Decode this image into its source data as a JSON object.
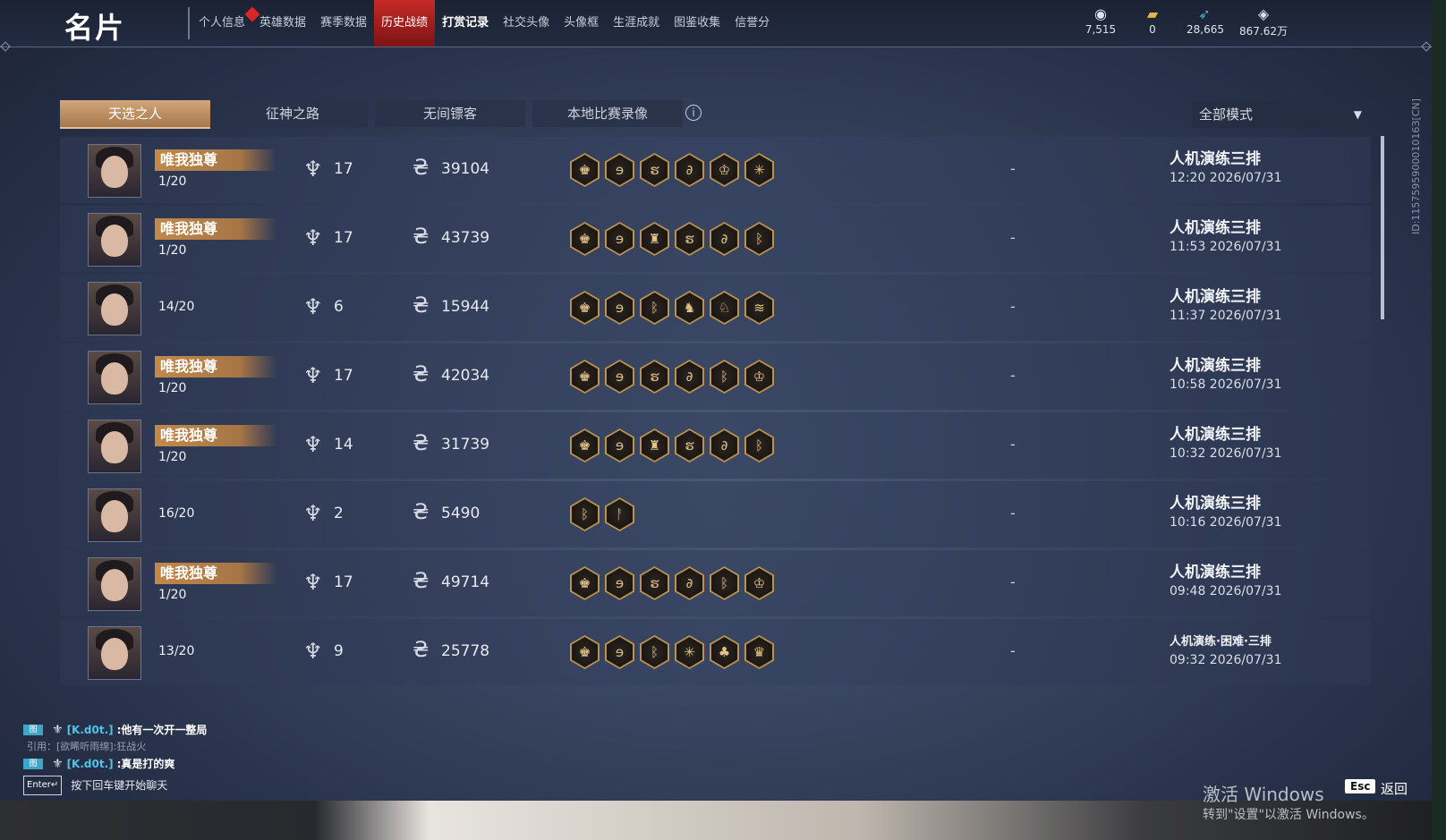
{
  "window": {
    "title": "名片"
  },
  "nav": {
    "tabs": [
      {
        "label": "个人信息"
      },
      {
        "label": "英雄数据"
      },
      {
        "label": "赛季数据"
      },
      {
        "label": "历史战绩"
      },
      {
        "label": "打赏记录"
      },
      {
        "label": "社交头像"
      },
      {
        "label": "头像框"
      },
      {
        "label": "生涯成就"
      },
      {
        "label": "图鉴收集"
      },
      {
        "label": "信誉分"
      }
    ],
    "active_index": 3
  },
  "currencies": [
    {
      "icon": "gold-ingot-icon",
      "value": "7,515"
    },
    {
      "icon": "ticket-icon",
      "value": "0"
    },
    {
      "icon": "feather-icon",
      "value": "28,665"
    },
    {
      "icon": "diamond-icon",
      "value": "867.62万"
    }
  ],
  "side_id": "ID:115759590001016З[CN]",
  "subtabs": [
    {
      "label": "天选之人"
    },
    {
      "label": "征神之路"
    },
    {
      "label": "无间镖客"
    },
    {
      "label": "本地比赛录像"
    }
  ],
  "mode_select": {
    "value": "全部模式"
  },
  "matches": [
    {
      "title": "唯我独尊",
      "rank": "1/20",
      "kills": "17",
      "money": "39104",
      "items": [
        "♚",
        "ɘ",
        "ຮ",
        "∂",
        "♔",
        "✳"
      ],
      "dash": "-",
      "mode": "人机演练三排",
      "time": "12:20  2026/07/31"
    },
    {
      "title": "唯我独尊",
      "rank": "1/20",
      "kills": "17",
      "money": "43739",
      "items": [
        "♚",
        "ɘ",
        "♜",
        "ຮ",
        "∂",
        "ᛒ"
      ],
      "dash": "-",
      "mode": "人机演练三排",
      "time": "11:53  2026/07/31"
    },
    {
      "title": "",
      "rank": "14/20",
      "kills": "6",
      "money": "15944",
      "items": [
        "♚",
        "ɘ",
        "ᛒ",
        "♞",
        "♘",
        "≋"
      ],
      "dash": "-",
      "mode": "人机演练三排",
      "time": "11:37  2026/07/31"
    },
    {
      "title": "唯我独尊",
      "rank": "1/20",
      "kills": "17",
      "money": "42034",
      "items": [
        "♚",
        "ɘ",
        "ຮ",
        "∂",
        "ᛒ",
        "♔"
      ],
      "dash": "-",
      "mode": "人机演练三排",
      "time": "10:58  2026/07/31"
    },
    {
      "title": "唯我独尊",
      "rank": "1/20",
      "kills": "14",
      "money": "31739",
      "items": [
        "♚",
        "ɘ",
        "♜",
        "ຮ",
        "∂",
        "ᛒ"
      ],
      "dash": "-",
      "mode": "人机演练三排",
      "time": "10:32  2026/07/31"
    },
    {
      "title": "",
      "rank": "16/20",
      "kills": "2",
      "money": "5490",
      "items": [
        "ᛒ",
        "ᚨ"
      ],
      "dash": "-",
      "mode": "人机演练三排",
      "time": "10:16  2026/07/31"
    },
    {
      "title": "唯我独尊",
      "rank": "1/20",
      "kills": "17",
      "money": "49714",
      "items": [
        "♚",
        "ɘ",
        "ຮ",
        "∂",
        "ᛒ",
        "♔"
      ],
      "dash": "-",
      "mode": "人机演练三排",
      "time": "09:48  2026/07/31"
    },
    {
      "title": "",
      "rank": "13/20",
      "kills": "9",
      "money": "25778",
      "items": [
        "♚",
        "ɘ",
        "ᛒ",
        "✳",
        "♣",
        "♛"
      ],
      "dash": "-",
      "mode": "人机演练·困难·三排",
      "time": "09:32  2026/07/31"
    }
  ],
  "chat": {
    "line1": {
      "badge": "图",
      "name": "[K.d0t.]",
      "msg": ":他有一次开一整局"
    },
    "quote": "引用：[欲晞听雨绵]:狂战火",
    "line2": {
      "badge": "图",
      "name": "[K.d0t.]",
      "msg": ":真是打的爽"
    },
    "enter_key": "Enter↵",
    "hint": "按下回车键开始聊天"
  },
  "windows_activation": {
    "line1": "激活 Windows",
    "line2": "转到\"设置\"以激活 Windows。"
  },
  "footer": {
    "esc_key": "Esc",
    "back_label": "返回"
  }
}
